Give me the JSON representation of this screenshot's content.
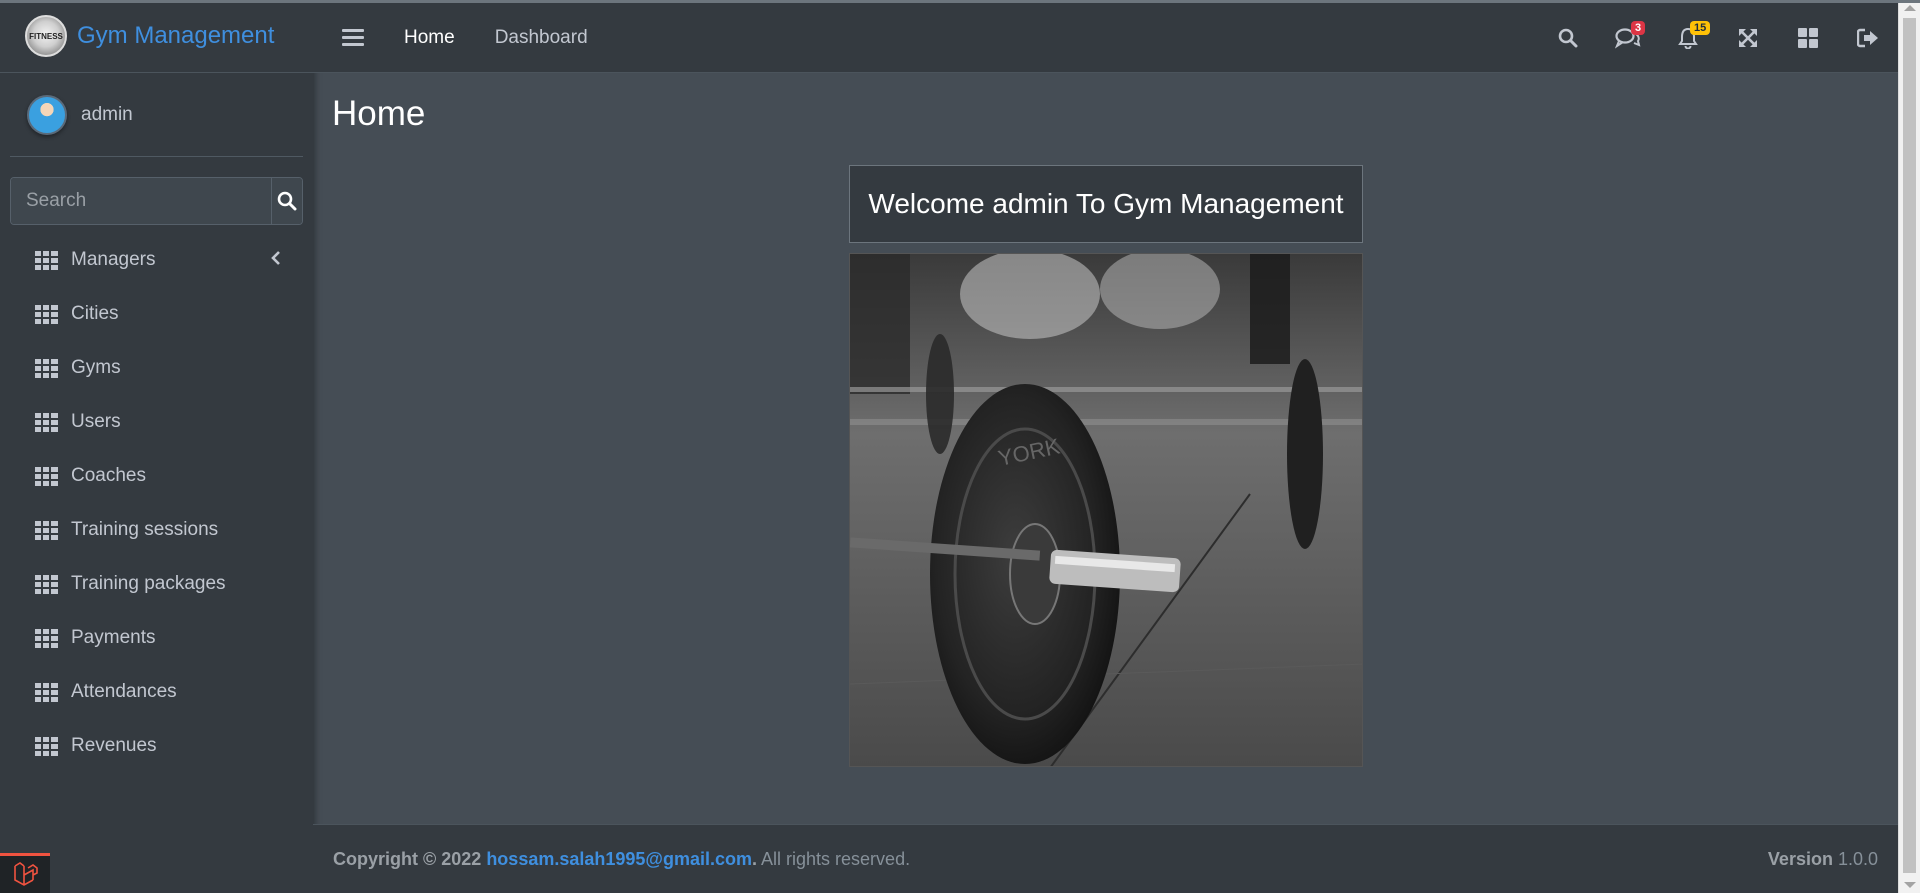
{
  "brand": {
    "title": "Gym Management",
    "logo_text": "FITNESS"
  },
  "user": {
    "name": "admin"
  },
  "search": {
    "placeholder": "Search"
  },
  "sidebar": {
    "items": [
      {
        "label": "Managers",
        "has_chevron": true
      },
      {
        "label": "Cities"
      },
      {
        "label": "Gyms"
      },
      {
        "label": "Users"
      },
      {
        "label": "Coaches"
      },
      {
        "label": "Training sessions"
      },
      {
        "label": "Training packages"
      },
      {
        "label": "Payments"
      },
      {
        "label": "Attendances"
      },
      {
        "label": "Revenues"
      }
    ]
  },
  "navbar": {
    "links": [
      "Home",
      "Dashboard"
    ],
    "messages_badge": "3",
    "notifications_badge": "15"
  },
  "content": {
    "page_title": "Home",
    "welcome_text": "Welcome admin To Gym Management",
    "hero_plate_text": "YORK"
  },
  "footer": {
    "copyright_prefix": "Copyright © 2022 ",
    "email": "hossam.salah1995@gmail.com",
    "suffix_dot": ".",
    "rights": " All rights reserved.",
    "version_label": "Version",
    "version_value": " 1.0.0"
  },
  "colors": {
    "sidebar_bg": "#343a40",
    "content_bg": "#454d55",
    "brand_accent": "#3f8fdf",
    "badge_danger": "#dc3545",
    "badge_warning": "#ffc107"
  }
}
